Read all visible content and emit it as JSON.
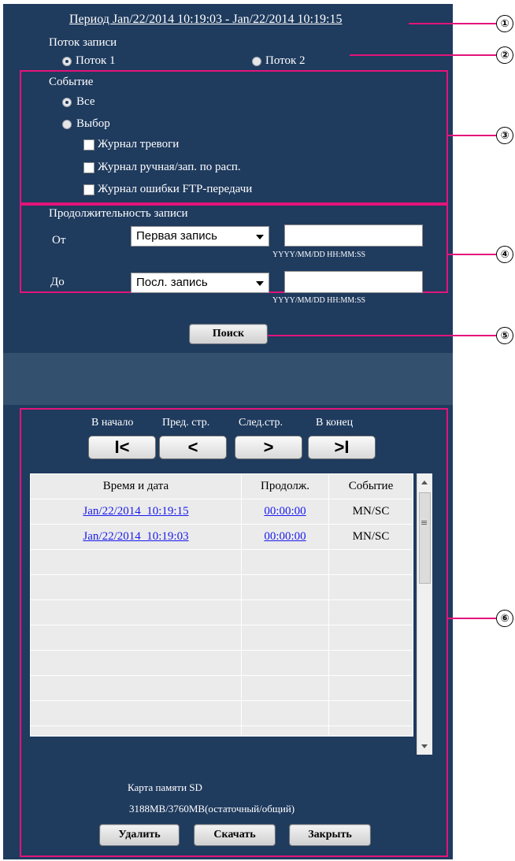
{
  "period": {
    "label": "Период Jan/22/2014 10:19:03 - Jan/22/2014 10:19:15"
  },
  "stream": {
    "title": "Поток записи",
    "options": [
      "Поток 1",
      "Поток 2"
    ],
    "selected": "Поток 1"
  },
  "event": {
    "title": "Событие",
    "options": [
      "Все",
      "Выбор"
    ],
    "selected": "Все",
    "checkboxes": [
      "Журнал тревоги",
      "Журнал ручная/зап. по расп.",
      "Журнал ошибки FTP-передачи"
    ]
  },
  "duration": {
    "title": "Продолжительность записи",
    "from_label": "От",
    "from_value": "Первая запись",
    "to_label": "До",
    "to_value": "Посл. запись",
    "format_hint": "YYYY/MM/DD HH:MM:SS"
  },
  "search_button": "Поиск",
  "nav": {
    "first_label": "В начало",
    "prev_label": "Пред. стр.",
    "next_label": "След.стр.",
    "last_label": "В конец",
    "first_glyph": "I<",
    "prev_glyph": "<",
    "next_glyph": ">",
    "last_glyph": ">I"
  },
  "table": {
    "headers": [
      "Время и дата",
      "Продолж.",
      "Событие"
    ],
    "rows": [
      {
        "datetime": "Jan/22/2014  10:19:15",
        "duration": "00:00:00",
        "event": "MN/SC"
      },
      {
        "datetime": "Jan/22/2014  10:19:03",
        "duration": "00:00:00",
        "event": "MN/SC"
      }
    ],
    "empty_rows": 8
  },
  "sd": {
    "title": "Карта памяти SD",
    "capacity": "3188MB/3760MB(остаточный/общий)"
  },
  "buttons": {
    "delete": "Удалить",
    "download": "Скачать",
    "close": "Закрыть"
  },
  "callouts": [
    "①",
    "②",
    "③",
    "④",
    "⑤",
    "⑥"
  ],
  "colors": {
    "panel": "#1f3b5e",
    "band": "#34506f",
    "highlight": "#e3147a",
    "link": "#1a1aee"
  }
}
